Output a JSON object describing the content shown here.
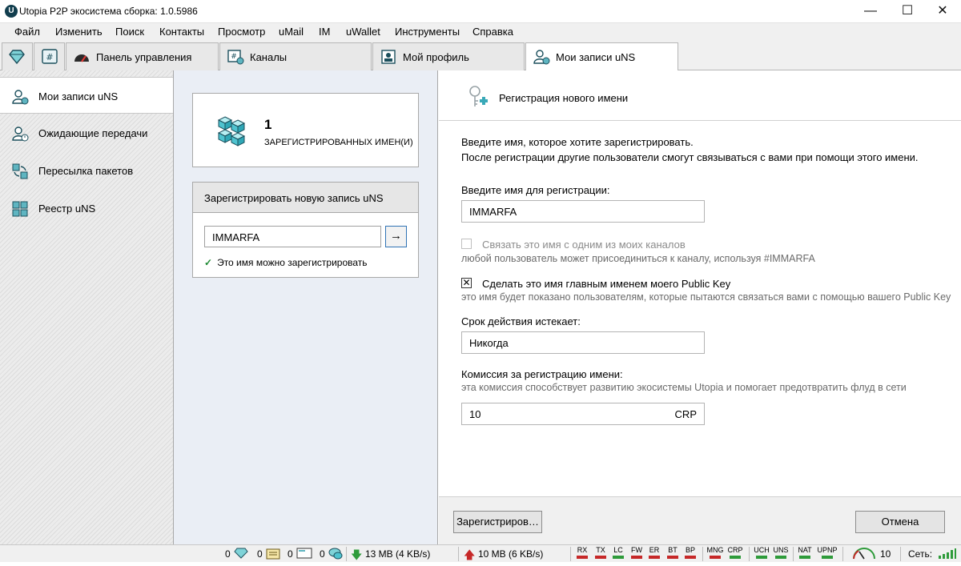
{
  "window": {
    "title": "Utopia P2P экосистема сборка: 1.0.5986",
    "logo_letter": "U"
  },
  "menu": [
    "Файл",
    "Изменить",
    "Поиск",
    "Контакты",
    "Просмотр",
    "uMail",
    "IM",
    "uWallet",
    "Инструменты",
    "Справка"
  ],
  "tabs": {
    "dashboard": "Панель управления",
    "channels": "Каналы",
    "profile": "Мой профиль",
    "uns": "Мои записи uNS"
  },
  "sidebar": {
    "items": [
      "Мои записи uNS",
      "Ожидающие передачи",
      "Пересылка пакетов",
      "Реестр uNS"
    ]
  },
  "stats": {
    "count": "1",
    "label": "ЗАРЕГИСТРИРОВАННЫХ ИМЕН(И)"
  },
  "register": {
    "heading": "Зарегистрировать новую запись uNS",
    "value": "IMMARFA",
    "go": "→",
    "status": "Это имя можно зарегистрировать",
    "status_color": "#1e8a33"
  },
  "form": {
    "title": "Регистрация нового имени",
    "intro1": "Введите имя, которое хотите зарегистрировать.",
    "intro2": "После регистрации другие пользователи смогут связываться с вами при помощи этого имени.",
    "name_label": "Введите имя для регистрации:",
    "name_value": "IMMARFA",
    "link_channel_label": "Связать это имя с одним из моих каналов",
    "link_channel_checked": false,
    "link_channel_hint": "любой пользователь может присоединиться к каналу, используя #IMMARFA",
    "primary_label": "Сделать это имя главным именем моего Public Key",
    "primary_checked": true,
    "primary_mark": "✕",
    "primary_hint": "это имя будет показано пользователям, которые пытаются связаться вами с помощью вашего Public Key",
    "expiry_label": "Срок действия истекает:",
    "expiry_value": "Никогда",
    "fee_label": "Комиссия за регистрацию имени:",
    "fee_hint": "эта комиссия способствует развитию экосистемы Utopia и помогает предотвратить флуд в сети",
    "fee_value": "10",
    "fee_currency": "CRP",
    "register_button": "Зарегистриров…",
    "cancel_button": "Отмена"
  },
  "status": {
    "crystals": "0",
    "uns_count": "0",
    "mail": "0",
    "chats": "0",
    "download": "13 MB (4 KB/s)",
    "upload": "10 MB (6 KB/s)",
    "indicators": [
      {
        "label": "RX",
        "color": "#c62828"
      },
      {
        "label": "TX",
        "color": "#c62828"
      },
      {
        "label": "LC",
        "color": "#2e9b3a"
      },
      {
        "label": "FW",
        "color": "#c62828"
      },
      {
        "label": "ER",
        "color": "#c62828"
      },
      {
        "label": "BT",
        "color": "#c62828"
      },
      {
        "label": "BP",
        "color": "#c62828"
      },
      {
        "label": "MNG",
        "color": "#c62828"
      },
      {
        "label": "CRP",
        "color": "#2e9b3a"
      },
      {
        "label": "UCH",
        "color": "#2e9b3a"
      },
      {
        "label": "UNS",
        "color": "#2e9b3a"
      },
      {
        "label": "NAT",
        "color": "#2e9b3a"
      },
      {
        "label": "UPNP",
        "color": "#2e9b3a"
      }
    ],
    "peers": "10",
    "network_label": "Сеть:"
  }
}
